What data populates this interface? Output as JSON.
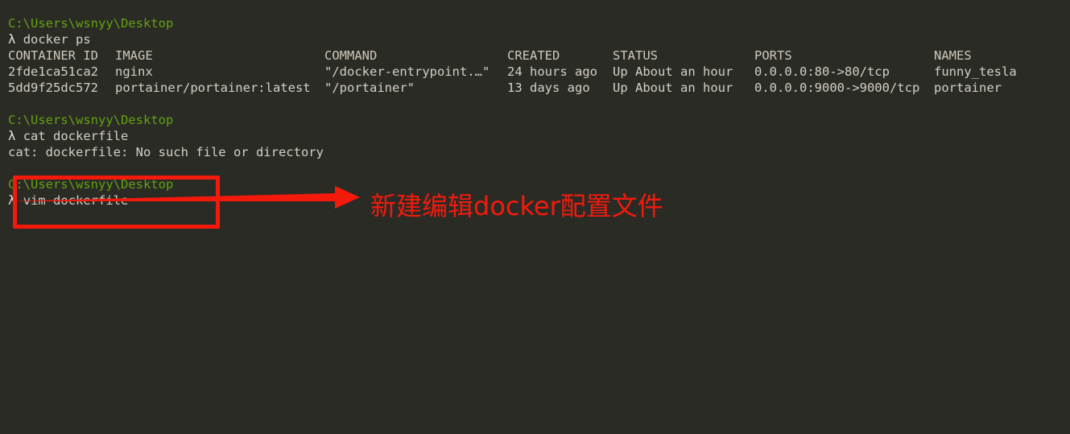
{
  "terminal": {
    "background_color": "#2b2b26",
    "foreground_color": "#d4cfc4",
    "prompt_color": "#62a013",
    "prompt_symbol": "λ",
    "blocks": {
      "first_prompt_path": "C:\\Users\\wsnyy\\Desktop",
      "first_command": "docker ps",
      "second_prompt_path": "C:\\Users\\wsnyy\\Desktop",
      "second_command": "cat dockerfile",
      "second_output": "cat: dockerfile: No such file or directory",
      "third_prompt_path": "C:\\Users\\wsnyy\\Desktop",
      "third_command": "vim dockerfile"
    }
  },
  "docker_ps": {
    "headers": {
      "container_id": "CONTAINER ID",
      "image": "IMAGE",
      "command": "COMMAND",
      "created": "CREATED",
      "status": "STATUS",
      "ports": "PORTS",
      "names": "NAMES"
    },
    "rows": [
      {
        "container_id": "2fde1ca51ca2",
        "image": "nginx",
        "command": "\"/docker-entrypoint.…\"",
        "created": "24 hours ago",
        "status": "Up About an hour",
        "ports": "0.0.0.0:80->80/tcp",
        "names": "funny_tesla"
      },
      {
        "container_id": "5dd9f25dc572",
        "image": "portainer/portainer:latest",
        "command": "\"/portainer\"",
        "created": "13 days ago",
        "status": "Up About an hour",
        "ports": "0.0.0.0:9000->9000/tcp",
        "names": "portainer"
      }
    ]
  },
  "annotation": {
    "color": "#f31a0c",
    "callout_text": "新建编辑docker配置文件",
    "highlight_target": "vim dockerfile"
  }
}
